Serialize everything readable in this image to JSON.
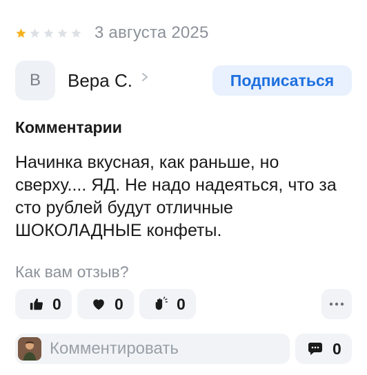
{
  "review": {
    "rating": 1,
    "max_rating": 5,
    "date": "3 августа 2025"
  },
  "author": {
    "initial": "В",
    "name": "Вера С.",
    "subscribe_label": "Подписаться"
  },
  "comments_section": {
    "title": "Комментарии",
    "text": "Начинка вкусная, как раньше, но сверху.... ЯД. Не надо надеяться, что за сто рублей будут отличные ШОКОЛАДНЫЕ конфеты."
  },
  "feedback": {
    "question": "Как вам отзыв?",
    "reactions": [
      {
        "icon": "thumbs-up-icon",
        "count": "0"
      },
      {
        "icon": "heart-icon",
        "count": "0"
      },
      {
        "icon": "clap-icon",
        "count": "0"
      }
    ],
    "more_icon": "more-dots-icon"
  },
  "comment_bar": {
    "placeholder": "Комментировать",
    "count": "0",
    "count_icon": "chat-bubble-icon"
  },
  "colors": {
    "star_filled": "#f5b31b",
    "star_empty": "#dde1e6",
    "accent": "#1e6fe0",
    "accent_bg": "#e8f1fd",
    "muted_text": "#8c9199",
    "chip_bg": "#f1f3f6"
  }
}
